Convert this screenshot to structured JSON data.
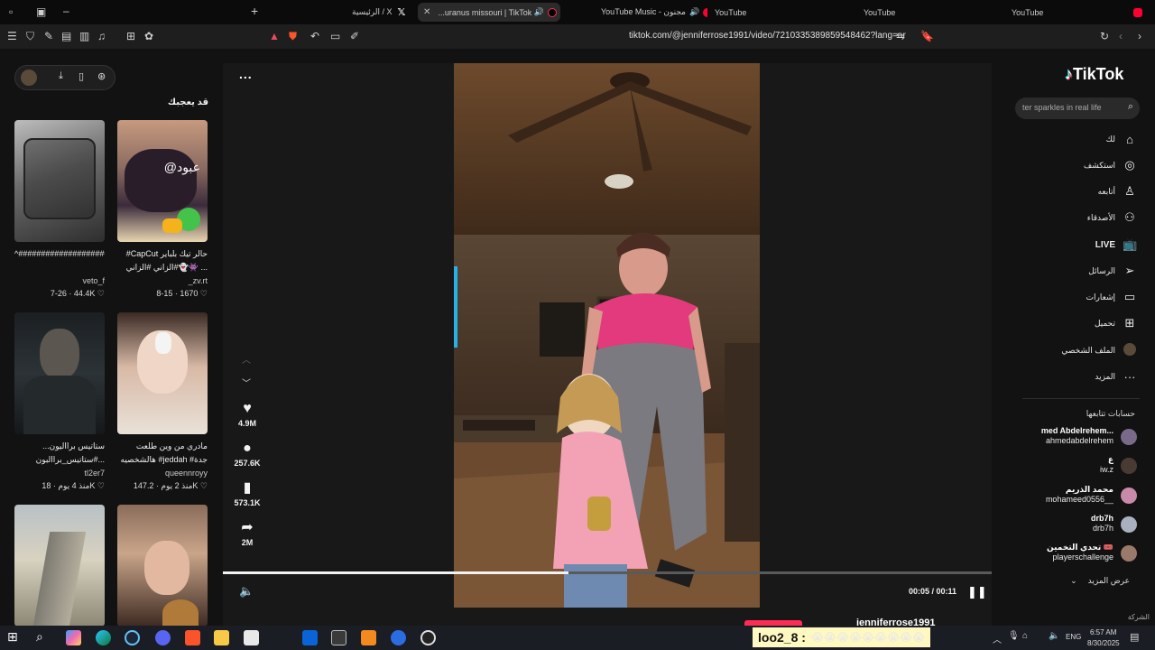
{
  "browser": {
    "tabs": [
      {
        "title": "الرئيسية / X",
        "favicon": "x-logo-icon"
      },
      {
        "title": "...uranus missouri | TikTok",
        "favicon": "tiktok-icon"
      },
      {
        "title": "YouTube Music - مجنون",
        "favicon": "youtube-music-icon"
      },
      {
        "title": "YouTube",
        "favicon": "youtube-icon"
      },
      {
        "title": "YouTube",
        "favicon": "youtube-icon"
      },
      {
        "title": "YouTube",
        "favicon": "youtube-icon"
      }
    ],
    "new_tab_symbol": "+",
    "url": "tiktok.com/@jenniferrose1991/video/7210335389859548462?lang=ar"
  },
  "left": {
    "title": "قد يعجبك",
    "cards": [
      {
        "caption": "#CapCut حالر تيك بلباير #الزاني #الزاني👻👾 ...",
        "author": "_zv.rt",
        "date": "8-15",
        "likes": "1670",
        "overlay": "@عبود"
      },
      {
        "caption": "^###############################...",
        "author": "veto_f",
        "date": "7-26",
        "likes": "44.4K",
        "overlay": ""
      },
      {
        "caption": "مادري من وين طلعت هالشخصيه #jeddah #جدة",
        "author": "queennroyy",
        "date": "منذ 2 يوم",
        "likes": "147.2K",
        "overlay": ""
      },
      {
        "caption": "ستاتيس برااليون... #ستاتيس_براالبون...",
        "author": "tl2er7",
        "date": "منذ 4 يوم",
        "likes": "18K",
        "overlay": ""
      },
      {
        "caption": "",
        "author": "",
        "date": "",
        "likes": "",
        "overlay": ""
      },
      {
        "caption": "",
        "author": "",
        "date": "",
        "likes": "",
        "overlay": ""
      }
    ]
  },
  "video": {
    "more_label": "...",
    "likes": "4.9M",
    "comments": "257.6K",
    "saves": "573.1K",
    "shares": "2M",
    "time": "00:05 / 00:11",
    "progress": 0.45,
    "author_partial": "jenniferrose1991"
  },
  "right": {
    "logo": "TikTok",
    "search_placeholder": "ter sparkles in real life",
    "nav": [
      {
        "label": "لك",
        "icon": "home-icon"
      },
      {
        "label": "استكشف",
        "icon": "compass-icon"
      },
      {
        "label": "أتابعه",
        "icon": "user-plus-icon"
      },
      {
        "label": "الأصدقاء",
        "icon": "friends-icon"
      },
      {
        "label": "LIVE",
        "icon": "live-tv-icon"
      },
      {
        "label": "الرسائل",
        "icon": "send-icon"
      },
      {
        "label": "إشعارات",
        "icon": "inbox-icon"
      },
      {
        "label": "تحميل",
        "icon": "upload-icon"
      },
      {
        "label": "الملف الشخصي",
        "icon": "avatar"
      },
      {
        "label": "المزيد",
        "icon": "more-icon"
      }
    ],
    "following_title": "حسابات تتابعها",
    "accounts": [
      {
        "name": "med Abdelrehem...",
        "handle": "ahmedabdelrehem"
      },
      {
        "name": "ع",
        "handle": "iw.z"
      },
      {
        "name": "محمد الذريم",
        "handle": "mohameed0556__"
      },
      {
        "name": "drb7h",
        "handle": "drb7h"
      },
      {
        "name": "تحدي التخمين 🎟️",
        "handle": "playerschallenge"
      }
    ],
    "see_more": "عرض المزيد",
    "company": "الشركة"
  },
  "taskbar": {
    "chat_user": "loo2_8 :",
    "chat_emojis": "😭😭😭😭😭😭😭😭😭",
    "language": "ENG",
    "time": "6:57 AM",
    "date": "8/30/2025"
  },
  "colors": {
    "tiktok_red": "#fe2c55",
    "tiktok_cyan": "#25f4ee",
    "bg": "#121212"
  }
}
